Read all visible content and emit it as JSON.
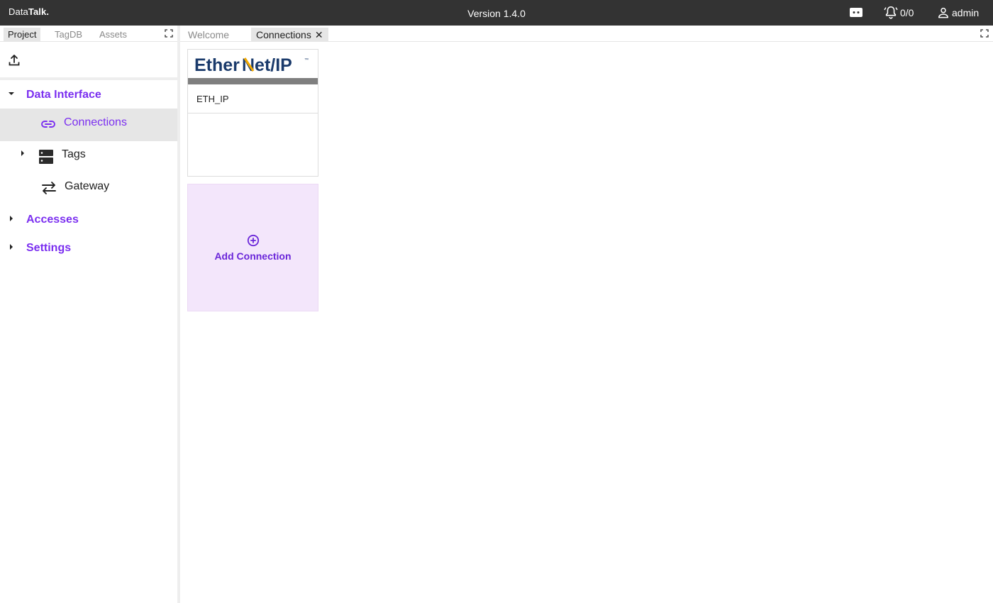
{
  "topbar": {
    "brand_part1": "Data",
    "brand_part2": "Talk.",
    "version": "Version 1.4.0",
    "alarm_count": "0/0",
    "user": "admin",
    "icons": {
      "chat": "chat-icon",
      "alarm": "bell-icon",
      "user": "user-icon"
    }
  },
  "left_panel": {
    "tabs": [
      {
        "label": "Project",
        "active": true
      },
      {
        "label": "TagDB",
        "active": false
      },
      {
        "label": "Assets",
        "active": false
      }
    ],
    "tree": {
      "data_interface": "Data Interface",
      "connections": "Connections",
      "tags": "Tags",
      "gateway": "Gateway",
      "accesses": "Accesses",
      "settings": "Settings"
    }
  },
  "main": {
    "tabs": [
      {
        "label": "Welcome",
        "active": false
      },
      {
        "label": "Connections",
        "active": true,
        "close": "✕"
      }
    ],
    "connection_card": {
      "logo_text_1": "Ether",
      "logo_text_2": "Net/IP",
      "logo_tm": "™",
      "name": "ETH_IP"
    },
    "add_card": {
      "label": "Add Connection"
    }
  },
  "colors": {
    "topbar": "#333333",
    "accent_purple": "#7b2ff0",
    "add_card_bg": "#f3e6fb",
    "logo_navy": "#1a3a6b",
    "logo_gold": "#f2a900"
  }
}
